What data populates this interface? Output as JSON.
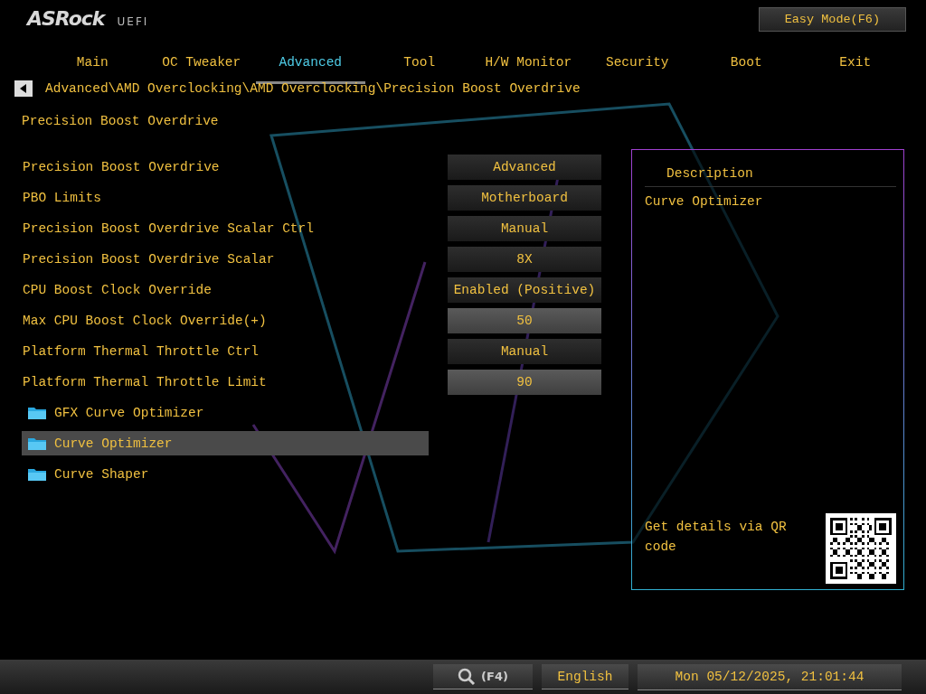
{
  "header": {
    "logo": "ASRock",
    "logo_suffix": "UEFI",
    "easy_mode_button": "Easy Mode(F6)"
  },
  "tabs": [
    {
      "label": "Main",
      "selected": false
    },
    {
      "label": "OC Tweaker",
      "selected": false
    },
    {
      "label": "Advanced",
      "selected": true
    },
    {
      "label": "Tool",
      "selected": false
    },
    {
      "label": "H/W Monitor",
      "selected": false
    },
    {
      "label": "Security",
      "selected": false
    },
    {
      "label": "Boot",
      "selected": false
    },
    {
      "label": "Exit",
      "selected": false
    }
  ],
  "breadcrumb": "Advanced\\AMD Overclocking\\AMD Overclocking\\Precision Boost Overdrive",
  "page_title": "Precision Boost Overdrive",
  "settings": [
    {
      "label": "Precision Boost Overdrive",
      "value": "Advanced",
      "kind": "dropdown"
    },
    {
      "label": "PBO Limits",
      "value": "Motherboard",
      "kind": "dropdown"
    },
    {
      "label": "Precision Boost Overdrive Scalar Ctrl",
      "value": "Manual",
      "kind": "dropdown"
    },
    {
      "label": "Precision Boost Overdrive Scalar",
      "value": "8X",
      "kind": "dropdown"
    },
    {
      "label": "CPU Boost Clock Override",
      "value": "Enabled (Positive)",
      "kind": "dropdown"
    },
    {
      "label": "Max CPU Boost Clock Override(+)",
      "value": "50",
      "kind": "number"
    },
    {
      "label": "Platform Thermal Throttle Ctrl",
      "value": "Manual",
      "kind": "dropdown"
    },
    {
      "label": "Platform Thermal Throttle Limit",
      "value": "90",
      "kind": "number"
    }
  ],
  "submenus": [
    {
      "label": "GFX Curve Optimizer",
      "selected": false
    },
    {
      "label": "Curve Optimizer",
      "selected": true
    },
    {
      "label": "Curve Shaper",
      "selected": false
    }
  ],
  "description": {
    "title": "Description",
    "text": "Curve Optimizer",
    "qr_caption": "Get details via QR code"
  },
  "status_bar": {
    "search_key": "(F4)",
    "language": "English",
    "datetime": "Mon 05/12/2025, 21:01:44"
  }
}
